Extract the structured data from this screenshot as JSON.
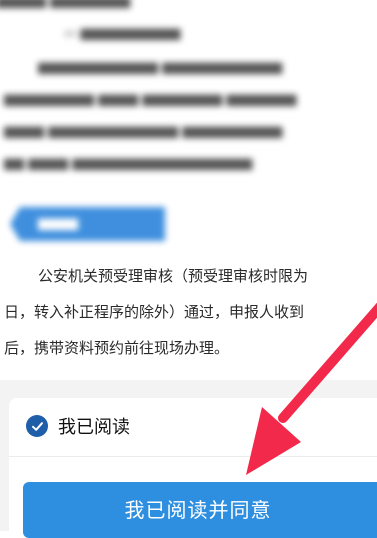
{
  "document": {
    "paragraph_lines": [
      "公安机关预受理审核（预受理审核时限为",
      "日，转入补正程序的除外）通过，申报人收到",
      "后，携带资料预约前往现场办理。"
    ]
  },
  "footer": {
    "checkbox_label": "我已阅读",
    "agree_button_label": "我已阅读并同意",
    "accent_color": "#2e8fe0",
    "check_color": "#1f5ea8"
  },
  "annotation": {
    "arrow_color": "#f2294a"
  }
}
